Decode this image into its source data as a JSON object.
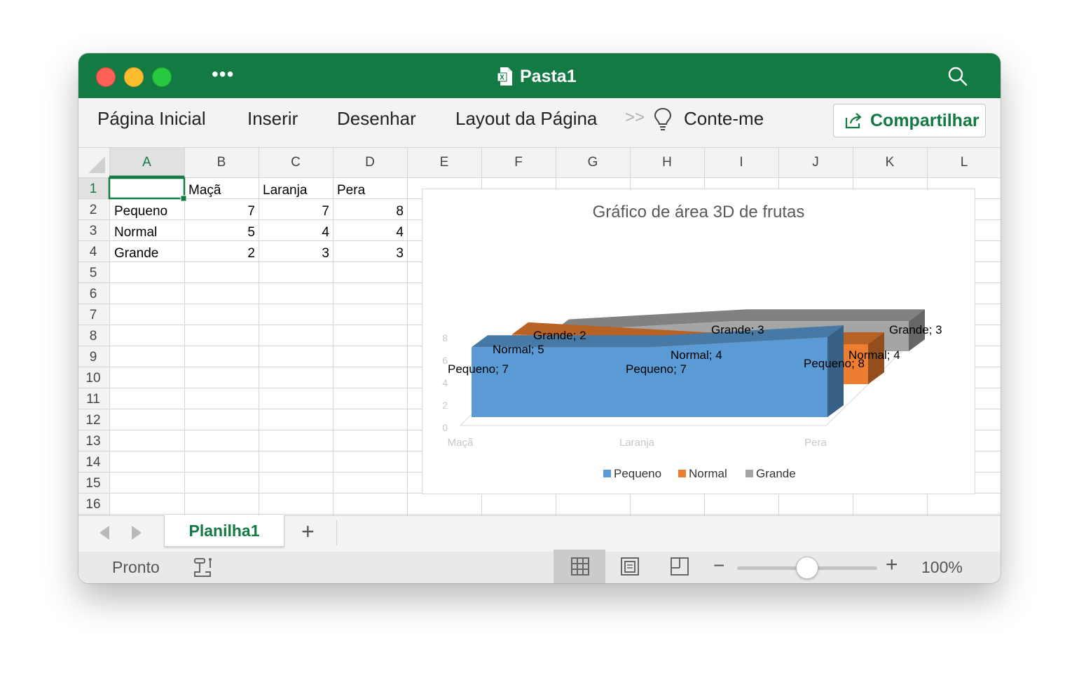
{
  "window": {
    "title": "Pasta1"
  },
  "menu": {
    "items": [
      "Página Inicial",
      "Inserir",
      "Desenhar",
      "Layout da Página"
    ],
    "tell_me": "Conte-me",
    "share_label": "Compartilhar"
  },
  "sheet": {
    "columns": [
      "A",
      "B",
      "C",
      "D",
      "E",
      "F",
      "G",
      "H",
      "I",
      "J",
      "K",
      "L"
    ],
    "rows": [
      "1",
      "2",
      "3",
      "4",
      "5",
      "6",
      "7",
      "8",
      "9",
      "10",
      "11",
      "12",
      "13",
      "14",
      "15",
      "16"
    ],
    "header_row": [
      "",
      "Maçã",
      "Laranja",
      "Pera"
    ],
    "data_rows": [
      {
        "label": "Pequeno",
        "values": [
          "7",
          "7",
          "8"
        ]
      },
      {
        "label": "Normal",
        "values": [
          "5",
          "4",
          "4"
        ]
      },
      {
        "label": "Grande",
        "values": [
          "2",
          "3",
          "3"
        ]
      }
    ]
  },
  "chart_data": {
    "type": "area",
    "title": "Gráfico de área 3D de frutas",
    "categories": [
      "Maçã",
      "Laranja",
      "Pera"
    ],
    "series": [
      {
        "name": "Pequeno",
        "values": [
          7,
          7,
          8
        ],
        "color": "#5b9bd5",
        "data_labels": [
          "Pequeno; 7",
          "Pequeno; 7",
          "Pequeno; 8"
        ]
      },
      {
        "name": "Normal",
        "values": [
          5,
          4,
          4
        ],
        "color": "#ed7d31",
        "data_labels": [
          "Normal; 5",
          "Normal; 4",
          "Normal; 4"
        ]
      },
      {
        "name": "Grande",
        "values": [
          2,
          3,
          3
        ],
        "color": "#a5a5a5",
        "data_labels": [
          "Grande; 2",
          "Grande; 3",
          "Grande; 3"
        ]
      }
    ],
    "y_ticks": [
      "0",
      "2",
      "4",
      "6",
      "8"
    ],
    "ylim": [
      0,
      8
    ],
    "legend": "bottom",
    "grid": false
  },
  "tabs": {
    "active": "Planilha1",
    "add_label": "+"
  },
  "status": {
    "text": "Pronto",
    "zoom": "100%",
    "zoom_minus": "−",
    "zoom_plus": "+"
  },
  "colors": {
    "accent": "#127a42"
  }
}
